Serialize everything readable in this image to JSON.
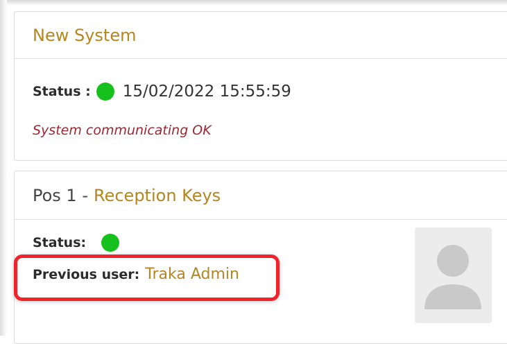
{
  "system": {
    "title": "New System",
    "status_label": "Status :",
    "timestamp": "15/02/2022 15:55:59",
    "message": "System communicating OK",
    "status_color": "#16c11e"
  },
  "position": {
    "pos_prefix": "Pos  1 -",
    "name": "Reception Keys",
    "status_label": "Status:",
    "status_color": "#16c11e",
    "previous_user_label": "Previous user:",
    "previous_user": "Traka Admin",
    "avatar_icon": "user-avatar-placeholder-icon"
  },
  "colors": {
    "accent": "#b58520",
    "message": "#9d2631",
    "highlight": "#f0222a"
  }
}
